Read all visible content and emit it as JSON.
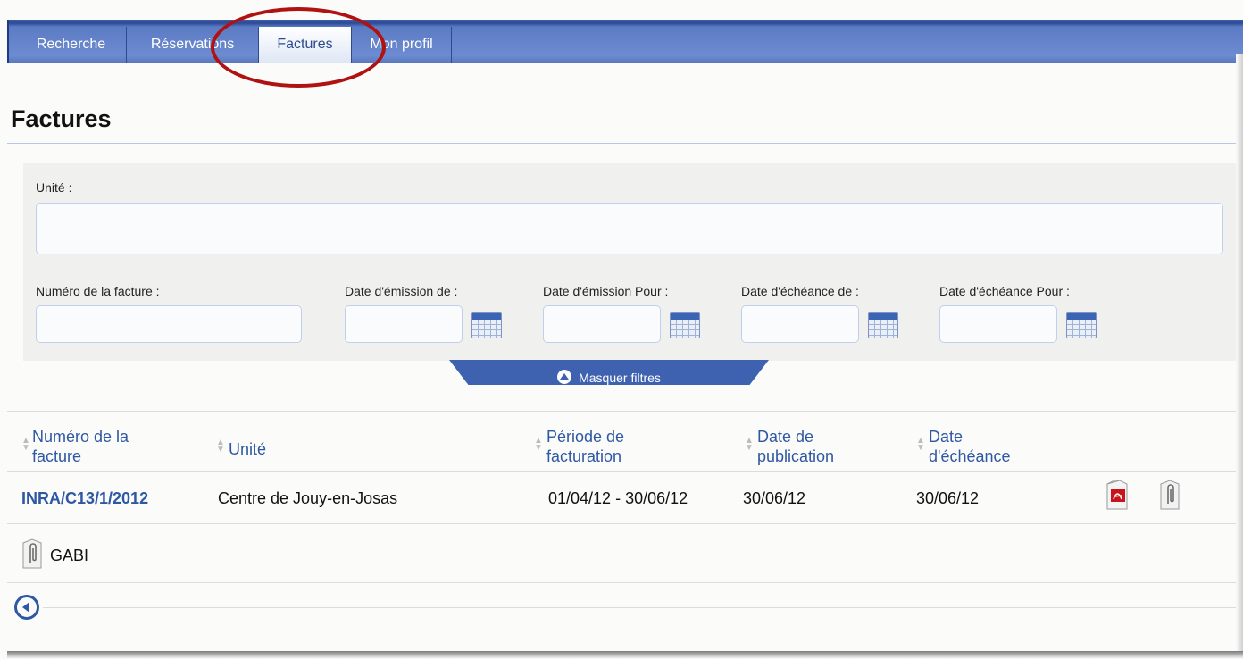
{
  "nav": {
    "tabs": [
      {
        "label": "Recherche"
      },
      {
        "label": "Réservations"
      },
      {
        "label": "Factures",
        "active": true
      },
      {
        "label": "Mon profil"
      }
    ]
  },
  "page": {
    "title": "Factures"
  },
  "filters": {
    "unit_label": "Unité :",
    "unit_value": "",
    "invoice_number_label": "Numéro de la facture :",
    "invoice_number_value": "",
    "issue_from_label": "Date d'émission de :",
    "issue_to_label": "Date d'émission Pour :",
    "due_from_label": "Date d'échéance de :",
    "due_to_label": "Date d'échéance Pour :",
    "hide_filters_label": "Masquer filtres"
  },
  "table": {
    "headers": {
      "invoice_number": [
        "Numéro de la",
        "facture"
      ],
      "unit": "Unité",
      "billing_period": [
        "Période de",
        "facturation"
      ],
      "publication_date": [
        "Date de",
        "publication"
      ],
      "due_date": [
        "Date",
        "d'échéance"
      ]
    },
    "rows": [
      {
        "invoice_number": "INRA/C13/1/2012",
        "unit": "Centre de Jouy-en-Josas",
        "billing_period": "01/04/12 - 30/06/12",
        "publication_date": "30/06/12",
        "due_date": "30/06/12",
        "icons": [
          "pdf-icon",
          "paperclip-icon"
        ]
      }
    ]
  },
  "attachment": {
    "label": "GABI",
    "icon": "paperclip-icon"
  },
  "colors": {
    "nav_blue": "#5b7bc4",
    "link_blue": "#2f58a4",
    "highlight_circle": "#b01212"
  }
}
